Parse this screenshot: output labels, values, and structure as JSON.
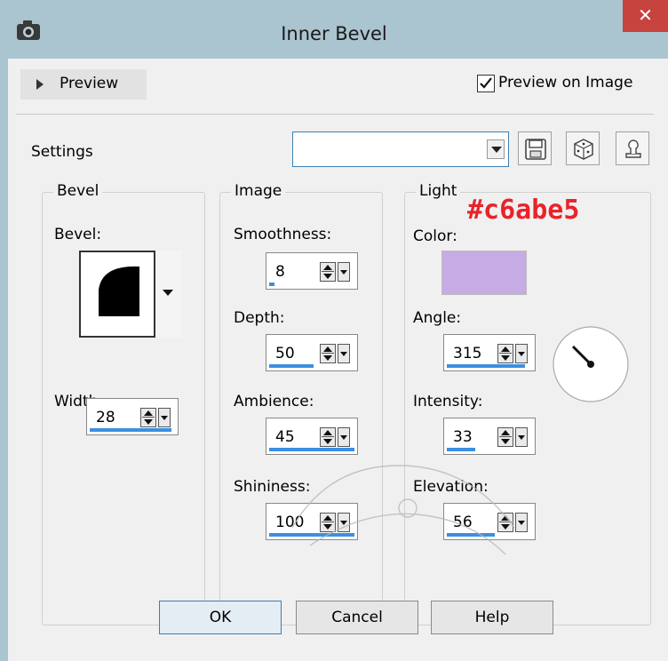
{
  "window": {
    "title": "Inner Bevel",
    "close_glyph": "✕"
  },
  "preview": {
    "toggle_label": "Preview",
    "on_image_label": "Preview on Image",
    "on_image_checked": true
  },
  "settings": {
    "label": "Settings",
    "value": ""
  },
  "bevel_group": {
    "title": "Bevel",
    "bevel_label": "Bevel:",
    "width_label": "Width:",
    "width_value": "28"
  },
  "image_group": {
    "title": "Image",
    "smoothness_label": "Smoothness:",
    "smoothness_value": "8",
    "depth_label": "Depth:",
    "depth_value": "50",
    "ambience_label": "Ambience:",
    "ambience_value": "45",
    "shininess_label": "Shininess:",
    "shininess_value": "100"
  },
  "light_group": {
    "title": "Light",
    "color_label": "Color:",
    "color_value": "#c6abe5",
    "color_hex_annotation": "#c6abe5",
    "angle_label": "Angle:",
    "angle_value": "315",
    "intensity_label": "Intensity:",
    "intensity_value": "33",
    "elevation_label": "Elevation:",
    "elevation_value": "56"
  },
  "buttons": {
    "ok": "OK",
    "cancel": "Cancel",
    "help": "Help"
  }
}
